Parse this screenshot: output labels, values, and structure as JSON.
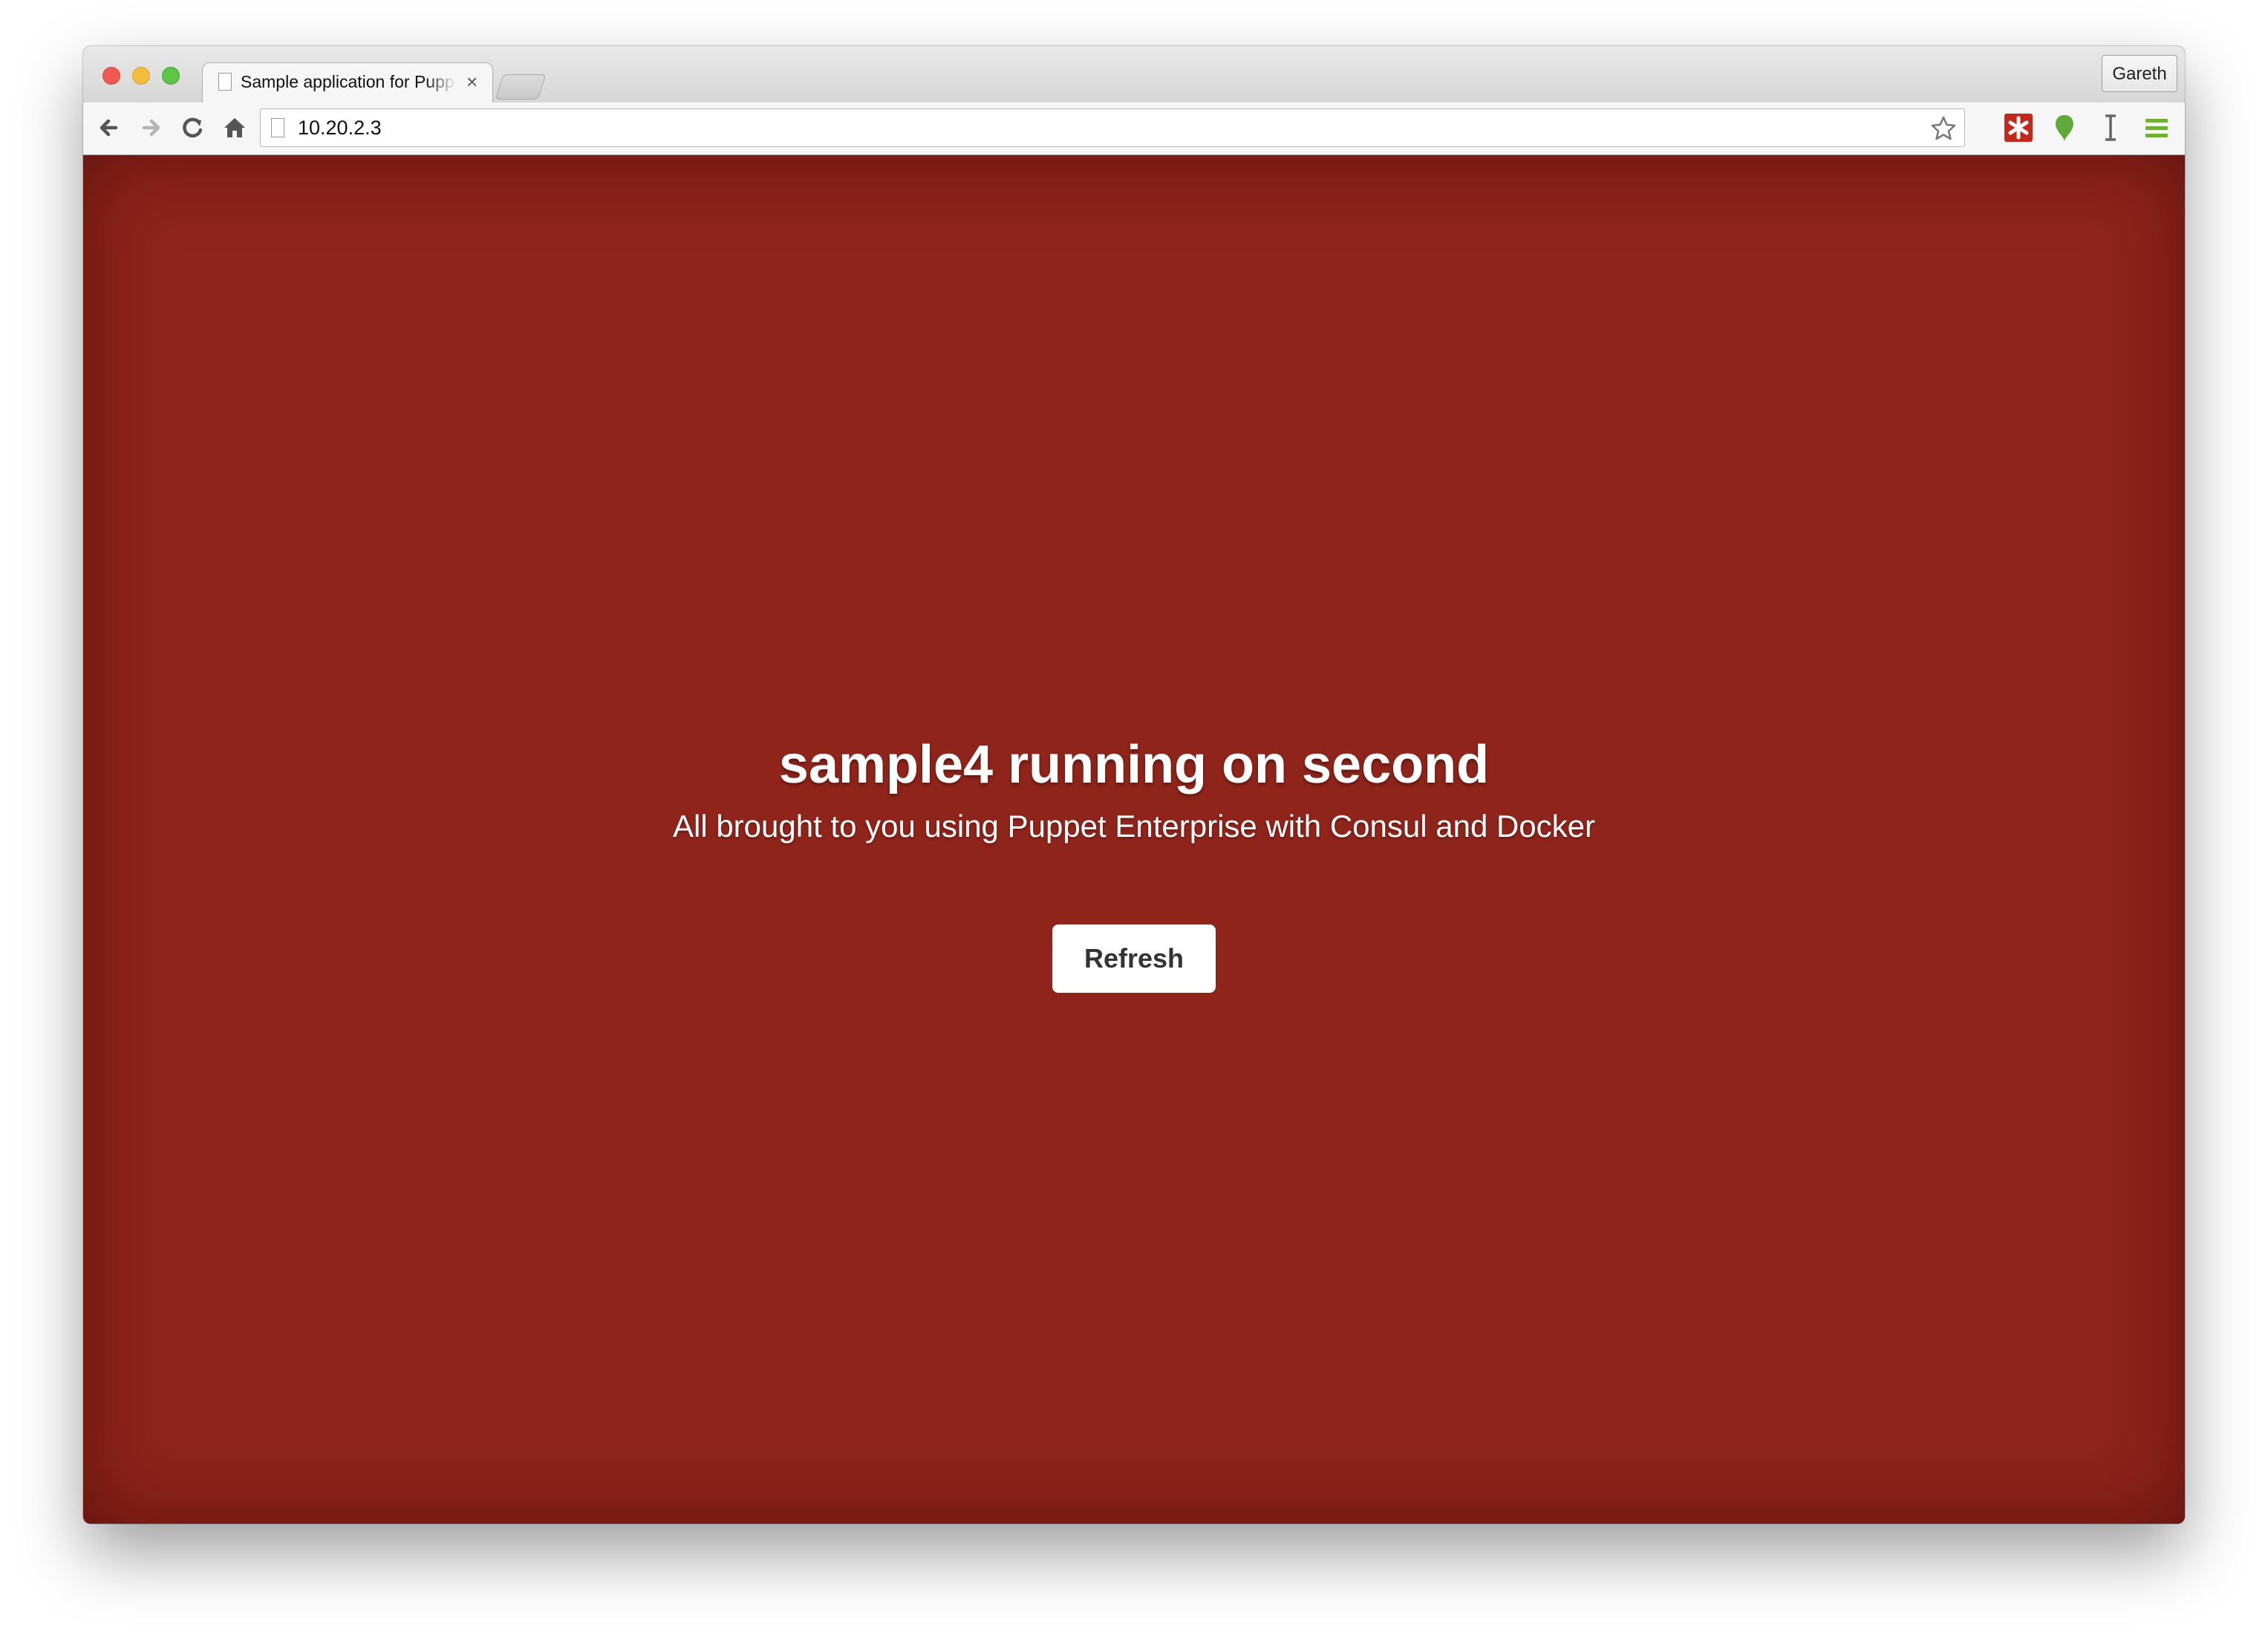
{
  "browser": {
    "tab_title": "Sample application for Puppet Enterprise",
    "tab_close_glyph": "×",
    "profile_name": "Gareth",
    "url": "10.20.2.3",
    "icons": [
      "back-icon",
      "forward-icon",
      "reload-icon",
      "home-icon",
      "bookmark-star-icon",
      "lastpass-icon",
      "evernote-icon",
      "cursor-text-icon",
      "menu-icon"
    ]
  },
  "page": {
    "headline": "sample4 running on second",
    "subheadline": "All brought to you using Puppet Enterprise with Consul and Docker",
    "refresh_label": "Refresh",
    "background_color": "#8f241b"
  }
}
